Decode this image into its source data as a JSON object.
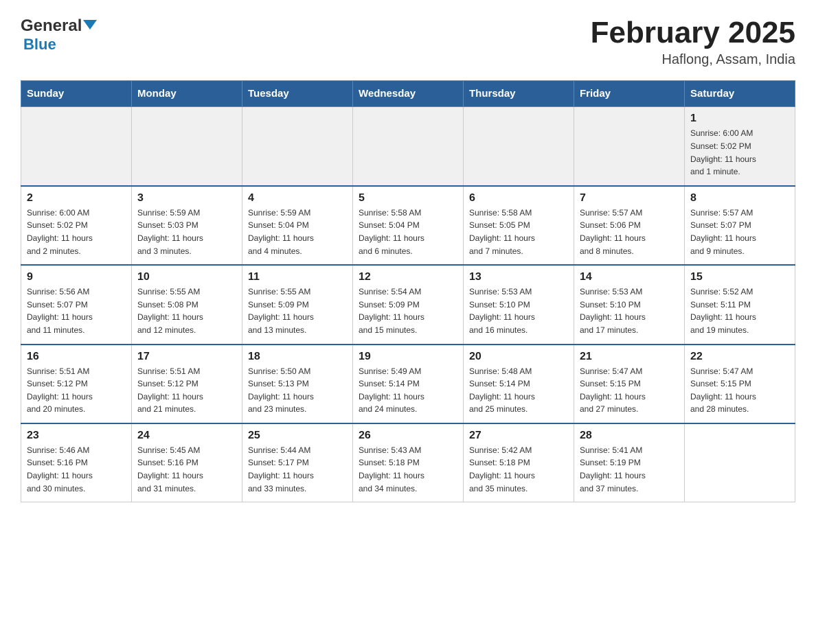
{
  "header": {
    "logo_general": "General",
    "logo_blue": "Blue",
    "month_title": "February 2025",
    "location": "Haflong, Assam, India"
  },
  "weekdays": [
    "Sunday",
    "Monday",
    "Tuesday",
    "Wednesday",
    "Thursday",
    "Friday",
    "Saturday"
  ],
  "weeks": [
    [
      {
        "day": "",
        "info": ""
      },
      {
        "day": "",
        "info": ""
      },
      {
        "day": "",
        "info": ""
      },
      {
        "day": "",
        "info": ""
      },
      {
        "day": "",
        "info": ""
      },
      {
        "day": "",
        "info": ""
      },
      {
        "day": "1",
        "info": "Sunrise: 6:00 AM\nSunset: 5:02 PM\nDaylight: 11 hours\nand 1 minute."
      }
    ],
    [
      {
        "day": "2",
        "info": "Sunrise: 6:00 AM\nSunset: 5:02 PM\nDaylight: 11 hours\nand 2 minutes."
      },
      {
        "day": "3",
        "info": "Sunrise: 5:59 AM\nSunset: 5:03 PM\nDaylight: 11 hours\nand 3 minutes."
      },
      {
        "day": "4",
        "info": "Sunrise: 5:59 AM\nSunset: 5:04 PM\nDaylight: 11 hours\nand 4 minutes."
      },
      {
        "day": "5",
        "info": "Sunrise: 5:58 AM\nSunset: 5:04 PM\nDaylight: 11 hours\nand 6 minutes."
      },
      {
        "day": "6",
        "info": "Sunrise: 5:58 AM\nSunset: 5:05 PM\nDaylight: 11 hours\nand 7 minutes."
      },
      {
        "day": "7",
        "info": "Sunrise: 5:57 AM\nSunset: 5:06 PM\nDaylight: 11 hours\nand 8 minutes."
      },
      {
        "day": "8",
        "info": "Sunrise: 5:57 AM\nSunset: 5:07 PM\nDaylight: 11 hours\nand 9 minutes."
      }
    ],
    [
      {
        "day": "9",
        "info": "Sunrise: 5:56 AM\nSunset: 5:07 PM\nDaylight: 11 hours\nand 11 minutes."
      },
      {
        "day": "10",
        "info": "Sunrise: 5:55 AM\nSunset: 5:08 PM\nDaylight: 11 hours\nand 12 minutes."
      },
      {
        "day": "11",
        "info": "Sunrise: 5:55 AM\nSunset: 5:09 PM\nDaylight: 11 hours\nand 13 minutes."
      },
      {
        "day": "12",
        "info": "Sunrise: 5:54 AM\nSunset: 5:09 PM\nDaylight: 11 hours\nand 15 minutes."
      },
      {
        "day": "13",
        "info": "Sunrise: 5:53 AM\nSunset: 5:10 PM\nDaylight: 11 hours\nand 16 minutes."
      },
      {
        "day": "14",
        "info": "Sunrise: 5:53 AM\nSunset: 5:10 PM\nDaylight: 11 hours\nand 17 minutes."
      },
      {
        "day": "15",
        "info": "Sunrise: 5:52 AM\nSunset: 5:11 PM\nDaylight: 11 hours\nand 19 minutes."
      }
    ],
    [
      {
        "day": "16",
        "info": "Sunrise: 5:51 AM\nSunset: 5:12 PM\nDaylight: 11 hours\nand 20 minutes."
      },
      {
        "day": "17",
        "info": "Sunrise: 5:51 AM\nSunset: 5:12 PM\nDaylight: 11 hours\nand 21 minutes."
      },
      {
        "day": "18",
        "info": "Sunrise: 5:50 AM\nSunset: 5:13 PM\nDaylight: 11 hours\nand 23 minutes."
      },
      {
        "day": "19",
        "info": "Sunrise: 5:49 AM\nSunset: 5:14 PM\nDaylight: 11 hours\nand 24 minutes."
      },
      {
        "day": "20",
        "info": "Sunrise: 5:48 AM\nSunset: 5:14 PM\nDaylight: 11 hours\nand 25 minutes."
      },
      {
        "day": "21",
        "info": "Sunrise: 5:47 AM\nSunset: 5:15 PM\nDaylight: 11 hours\nand 27 minutes."
      },
      {
        "day": "22",
        "info": "Sunrise: 5:47 AM\nSunset: 5:15 PM\nDaylight: 11 hours\nand 28 minutes."
      }
    ],
    [
      {
        "day": "23",
        "info": "Sunrise: 5:46 AM\nSunset: 5:16 PM\nDaylight: 11 hours\nand 30 minutes."
      },
      {
        "day": "24",
        "info": "Sunrise: 5:45 AM\nSunset: 5:16 PM\nDaylight: 11 hours\nand 31 minutes."
      },
      {
        "day": "25",
        "info": "Sunrise: 5:44 AM\nSunset: 5:17 PM\nDaylight: 11 hours\nand 33 minutes."
      },
      {
        "day": "26",
        "info": "Sunrise: 5:43 AM\nSunset: 5:18 PM\nDaylight: 11 hours\nand 34 minutes."
      },
      {
        "day": "27",
        "info": "Sunrise: 5:42 AM\nSunset: 5:18 PM\nDaylight: 11 hours\nand 35 minutes."
      },
      {
        "day": "28",
        "info": "Sunrise: 5:41 AM\nSunset: 5:19 PM\nDaylight: 11 hours\nand 37 minutes."
      },
      {
        "day": "",
        "info": ""
      }
    ]
  ]
}
